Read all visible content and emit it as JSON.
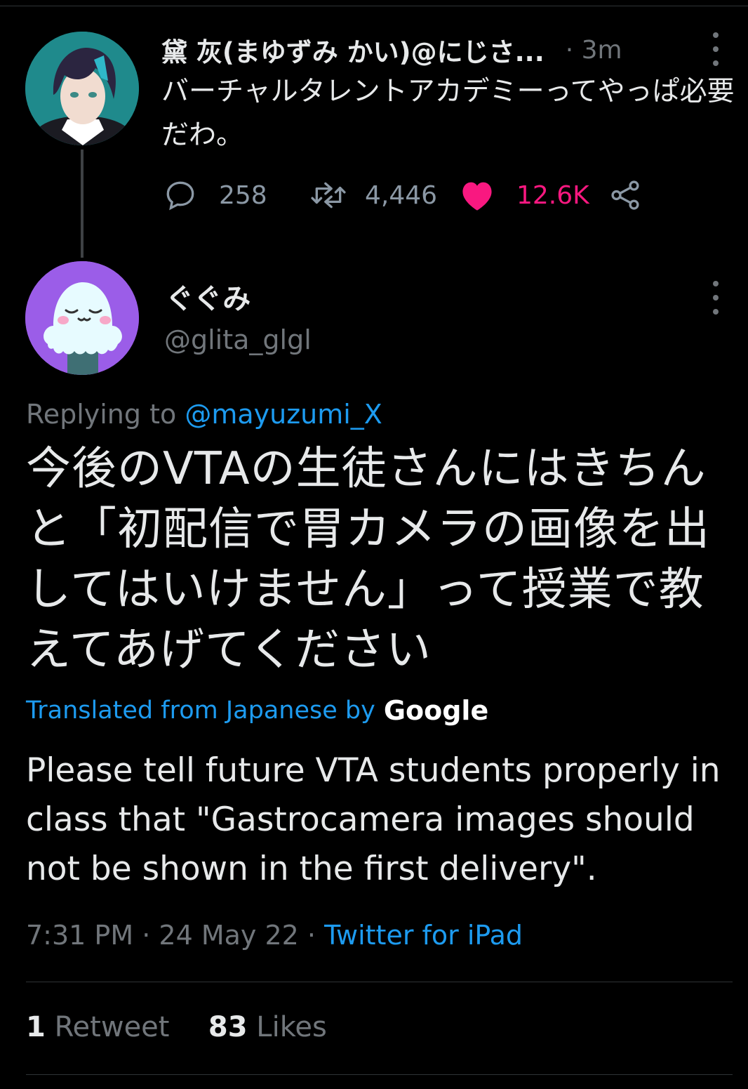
{
  "parent_tweet": {
    "display_name": "黛 灰(まゆずみ かい)@にじさ...",
    "time": "· 3m",
    "text": "バーチャルタレントアカデミーってやっぱ必要だわ。",
    "replies": "258",
    "retweets": "4,446",
    "likes": "12.6K",
    "liked": true
  },
  "reply_tweet": {
    "display_name": "ぐぐみ",
    "handle": "@glita_glgl",
    "replying_label": "Replying to ",
    "replying_to": "@mayuzumi_X",
    "text_jp": "今後のVTAの生徒さんにはきちんと「初配信で胃カメラの画像を出してはいけません」って授業で教えてあげてください",
    "translated_label": "Translated from Japanese by",
    "translated_provider": "Google",
    "text_en": "Please tell future VTA students properly in class that \"Gastrocamera images should not be shown in the first delivery\".",
    "time": "7:31 PM",
    "date": "24 May 22",
    "source": "Twitter for iPad",
    "retweet_count": "1",
    "retweet_label": "Retweet",
    "like_count": "83",
    "like_label": "Likes"
  },
  "colors": {
    "background": "#000000",
    "accent": "#1d9bf0",
    "like": "#f91880",
    "muted": "#71767b"
  },
  "icons": [
    "more-options-icon",
    "reply-icon",
    "retweet-icon",
    "heart-icon",
    "share-icon"
  ]
}
